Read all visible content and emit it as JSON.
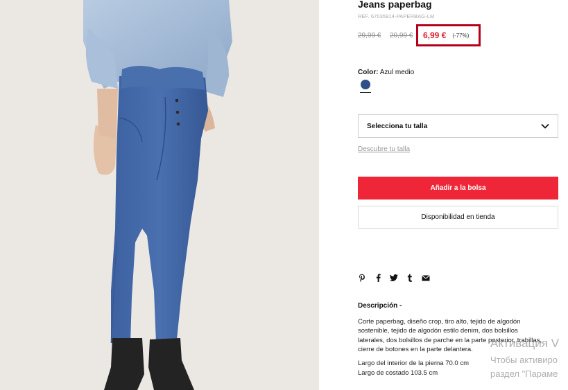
{
  "product": {
    "title": "Jeans paperbag",
    "ref": "REF. 67035914-PAPERBAG-LM",
    "old_price_1": "29,99 €",
    "old_price_2": "20,99 €",
    "price": "6,99 €",
    "discount": "(-77%)"
  },
  "color": {
    "label": "Color:",
    "value": "Azul medio",
    "swatch_hex": "#2f4f86"
  },
  "size": {
    "select_label": "Selecciona tu talla",
    "guide_link": "Descubre tu talla"
  },
  "actions": {
    "add_to_bag": "Añadir a la bolsa",
    "store_availability": "Disponibilidad en tienda"
  },
  "share_icons": [
    "pinterest-icon",
    "facebook-icon",
    "twitter-icon",
    "tumblr-icon",
    "email-icon"
  ],
  "description": {
    "title": "Descripción -",
    "text": "Corte paperbag, diseño crop, tiro alto, tejido de algodón sostenible, tejido de algodón estilo denim, dos bolsillos laterales, dos bolsillos de parche en la parte posterior, trabillas, cierre de botones en la parte delantera.",
    "spec_1": "Largo del interior de la pierna 70.0 cm",
    "spec_2": "Largo de costado 103.5 cm"
  },
  "watermark": {
    "line_1": "Активация V",
    "line_2": "Чтобы активиро",
    "line_3": "раздел \"Параме"
  },
  "colors": {
    "accent_red": "#ef2638",
    "price_red": "#e01a2b",
    "highlight_box": "#b3001b"
  }
}
